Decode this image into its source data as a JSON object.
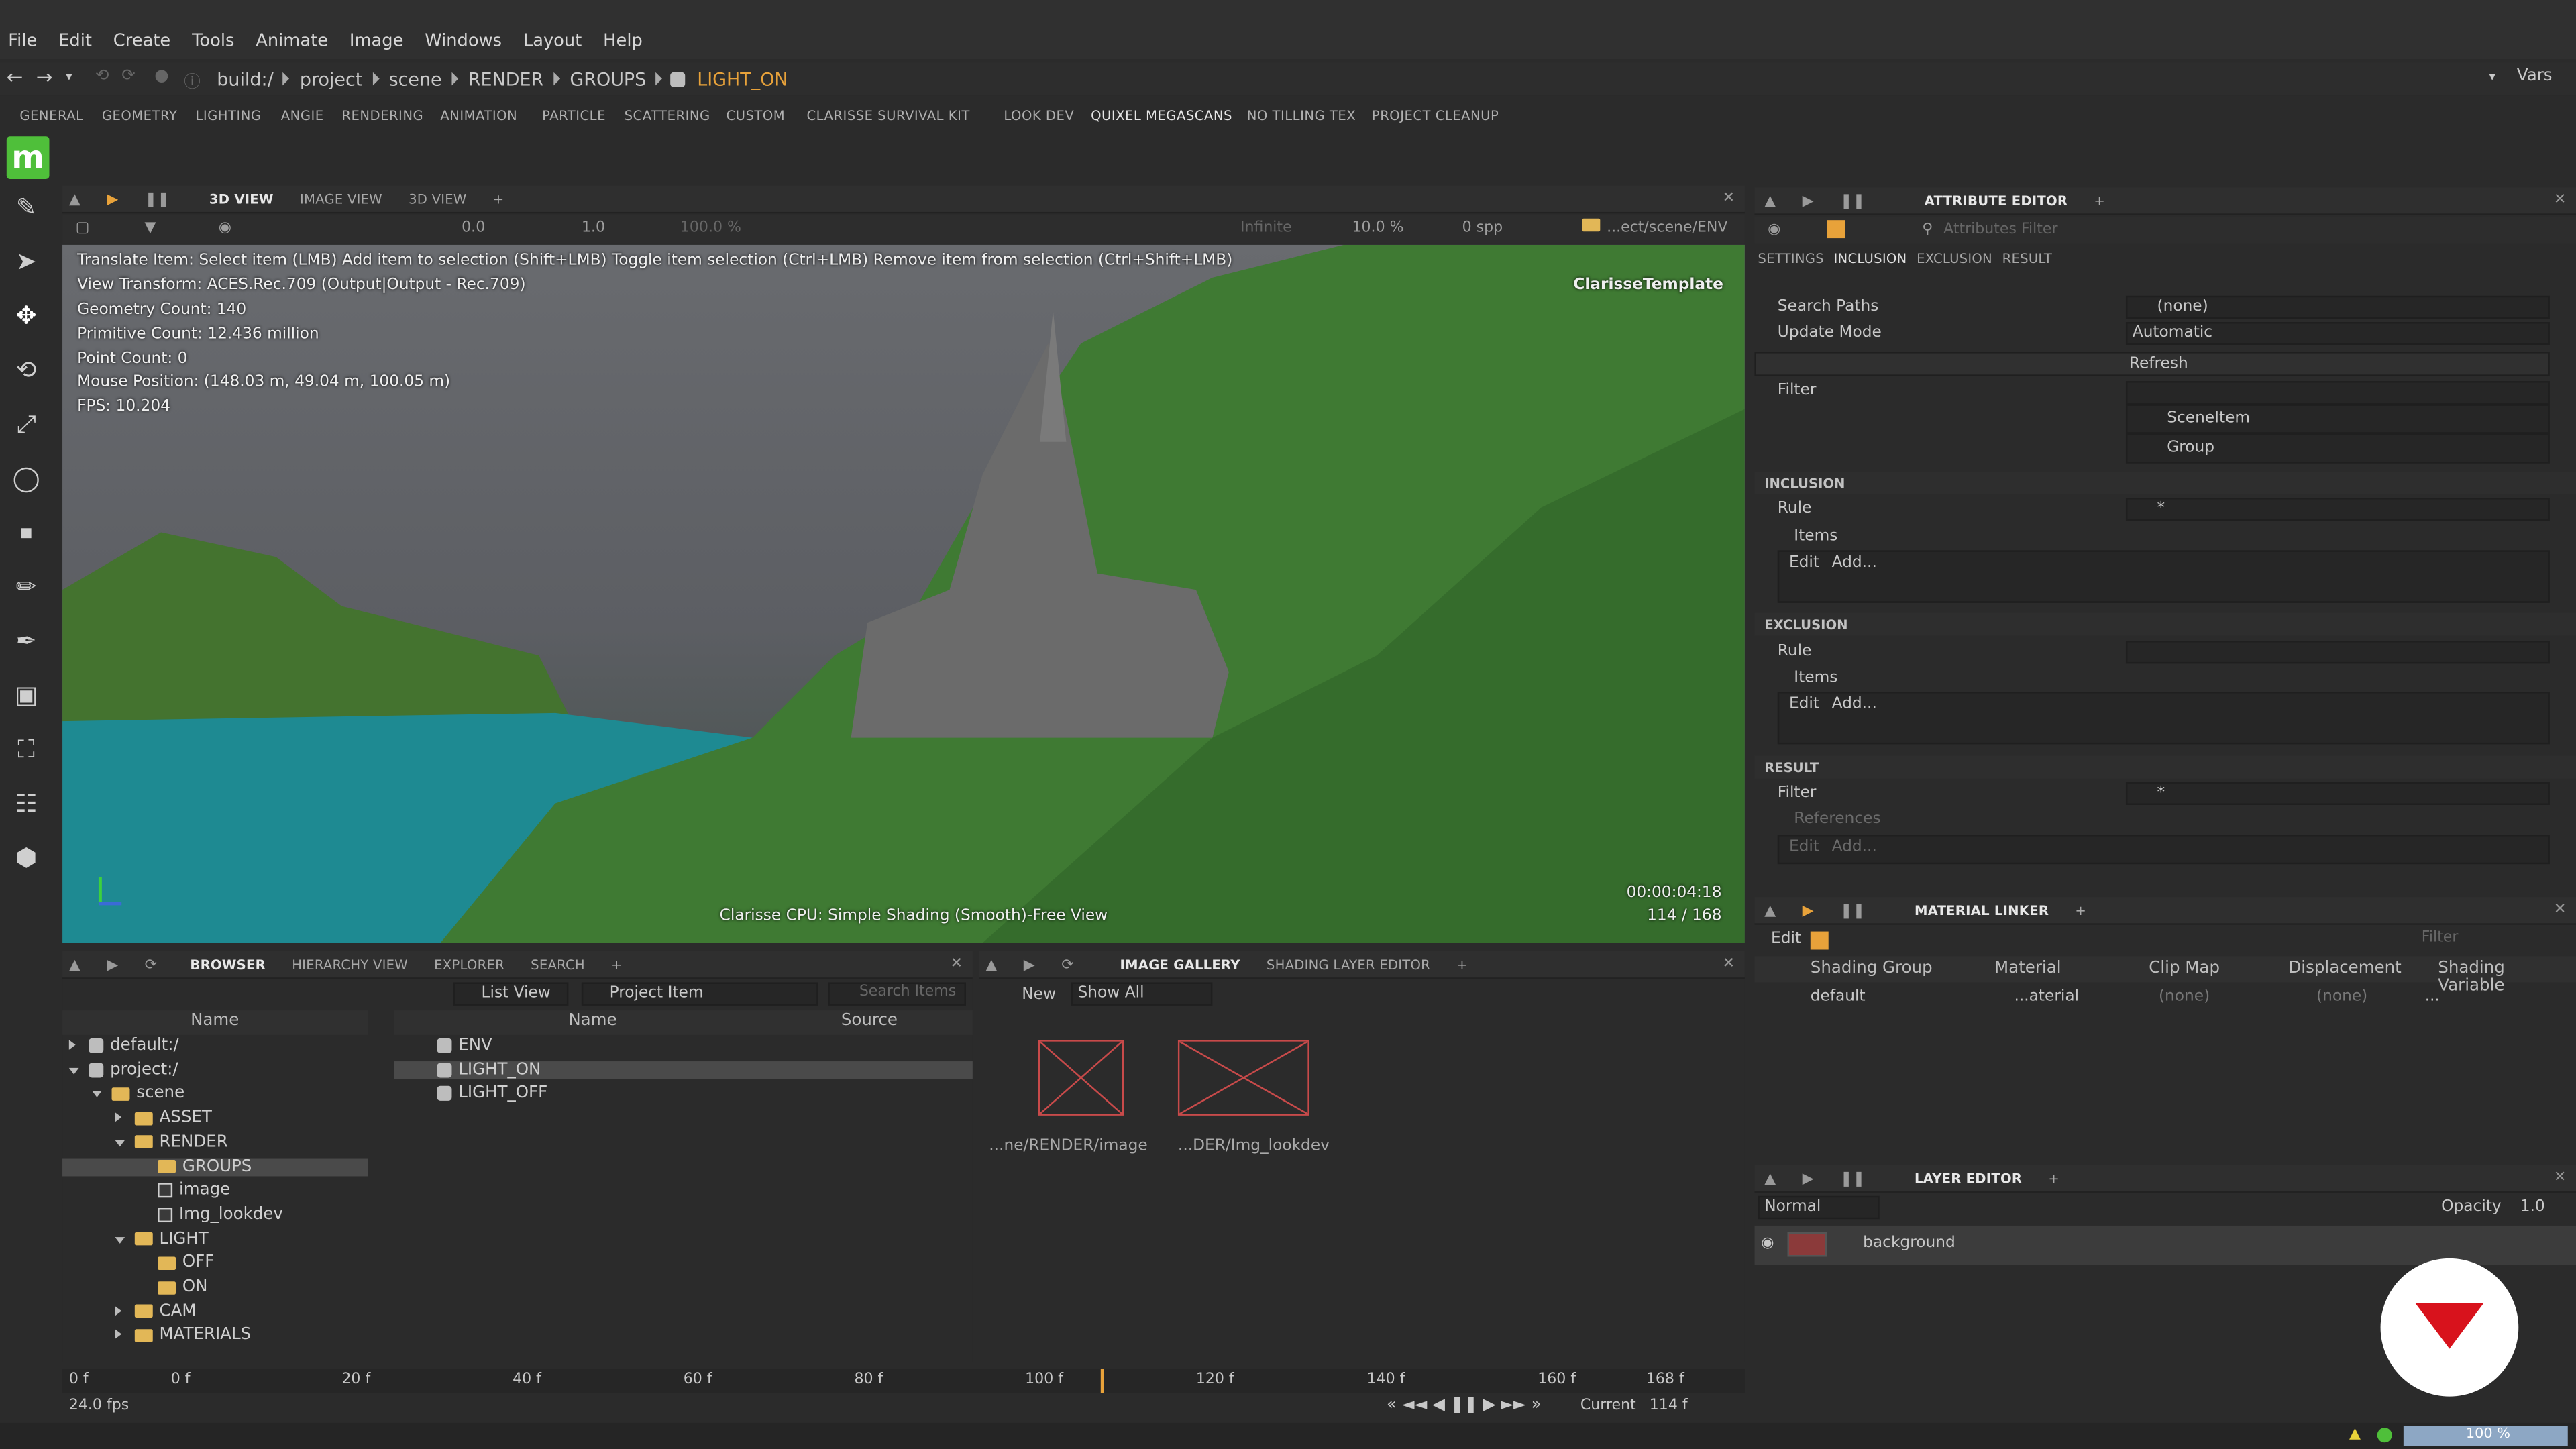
{
  "menu": [
    "File",
    "Edit",
    "Create",
    "Tools",
    "Animate",
    "Image",
    "Windows",
    "Layout",
    "Help"
  ],
  "breadcrumb": [
    "build:/",
    "project",
    "scene",
    "RENDER",
    "GROUPS",
    "LIGHT_ON"
  ],
  "vars_label": "Vars",
  "shelf_tabs": [
    "GENERAL",
    "GEOMETRY",
    "LIGHTING",
    "ANGIE",
    "RENDERING",
    "ANIMATION",
    "PARTICLE",
    "SCATTERING",
    "CUSTOM",
    "CLARISSE SURVIVAL KIT",
    "LOOK DEV",
    "QUIXEL MEGASCANS",
    "NO TILLING TEX",
    "PROJECT CLEANUP"
  ],
  "logo_letter": "m",
  "viewport_panel": {
    "tabs": [
      "3D VIEW",
      "IMAGE VIEW",
      "3D VIEW"
    ],
    "toolbar": {
      "val1": "0.0",
      "val2": "1.0",
      "val3": "100.0 %",
      "infinite": "Infinite",
      "zoom": "10.0 %",
      "spp": "0 spp",
      "path": "...ect/scene/ENV"
    },
    "hint": "Translate Item: Select item (LMB)  Add item to selection (Shift+LMB)  Toggle item selection (Ctrl+LMB)  Remove item from selection (Ctrl+Shift+LMB)",
    "info": [
      "View Transform: ACES.Rec.709 (Output|Output - Rec.709)",
      "Geometry Count: 140",
      "Primitive Count: 12.436 million",
      "Point Count: 0",
      "Mouse Position:  (148.03 m, 49.04 m, 100.05 m)",
      "FPS: 10.204"
    ],
    "template": "ClarisseTemplate",
    "status": "Clarisse CPU: Simple Shading (Smooth)-Free View",
    "timecode": "00:00:04:18",
    "frame": "114 / 168"
  },
  "attr": {
    "title": "ATTRIBUTE EDITOR",
    "filter_placeholder": "Attributes Filter",
    "tabs": [
      "SETTINGS",
      "INCLUSION",
      "EXCLUSION",
      "RESULT"
    ],
    "search_paths_label": "Search Paths",
    "search_paths_value": "(none)",
    "update_mode_label": "Update Mode",
    "update_mode_value": "Automatic",
    "refresh": "Refresh",
    "filter_label": "Filter",
    "filter_items": [
      "SceneItem",
      "Group"
    ],
    "inclusion": "INCLUSION",
    "rule": "Rule",
    "rule_value": "*",
    "items": "Items",
    "edit": "Edit",
    "add": "Add...",
    "exclusion": "EXCLUSION",
    "result": "RESULT",
    "result_filter_value": "*",
    "references": "References"
  },
  "material_linker": {
    "title": "MATERIAL LINKER",
    "edit": "Edit",
    "filter_placeholder": "Filter",
    "columns": [
      "Shading Group",
      "Material",
      "Clip Map",
      "Displacement",
      "Shading Variable"
    ],
    "row": {
      "group": "default",
      "material": "...aterial",
      "clip": "(none)",
      "disp": "(none)",
      "var": "..."
    }
  },
  "layer_editor": {
    "title": "LAYER EDITOR",
    "blend": "Normal",
    "opacity_label": "Opacity",
    "opacity": "1.0",
    "layer": "background"
  },
  "browser": {
    "tabs": [
      "BROWSER",
      "HIERARCHY VIEW",
      "EXPLORER",
      "SEARCH"
    ],
    "list_view": "List View",
    "type": "Project Item",
    "search_placeholder": "Search Items",
    "col_name": "Name",
    "col_name2": "Name",
    "col_source": "Source",
    "tree": [
      {
        "label": "default:/",
        "indent": 0,
        "arrow": "right",
        "icon": "root"
      },
      {
        "label": "project:/",
        "indent": 0,
        "arrow": "down",
        "icon": "root"
      },
      {
        "label": "scene",
        "indent": 1,
        "arrow": "down",
        "icon": "folder"
      },
      {
        "label": "ASSET",
        "indent": 2,
        "arrow": "right",
        "icon": "folder"
      },
      {
        "label": "RENDER",
        "indent": 2,
        "arrow": "down",
        "icon": "folder"
      },
      {
        "label": "GROUPS",
        "indent": 3,
        "arrow": "",
        "icon": "folder",
        "selected": true
      },
      {
        "label": "image",
        "indent": 3,
        "arrow": "",
        "icon": "doc"
      },
      {
        "label": "Img_lookdev",
        "indent": 3,
        "arrow": "",
        "icon": "doc"
      },
      {
        "label": "LIGHT",
        "indent": 2,
        "arrow": "down",
        "icon": "folder"
      },
      {
        "label": "OFF",
        "indent": 3,
        "arrow": "",
        "icon": "folder"
      },
      {
        "label": "ON",
        "indent": 3,
        "arrow": "",
        "icon": "folder"
      },
      {
        "label": "CAM",
        "indent": 2,
        "arrow": "right",
        "icon": "folder"
      },
      {
        "label": "MATERIALS",
        "indent": 2,
        "arrow": "right",
        "icon": "folder"
      }
    ],
    "items": [
      "ENV",
      "LIGHT_ON",
      "LIGHT_OFF"
    ]
  },
  "gallery": {
    "tabs": [
      "IMAGE GALLERY",
      "SHADING LAYER EDITOR"
    ],
    "new": "New",
    "show_all": "Show All",
    "images": [
      "...ne/RENDER/image",
      "...DER/Img_lookdev"
    ]
  },
  "timeline": {
    "start": "0 f",
    "ticks": [
      "0 f",
      "20 f",
      "40 f",
      "60 f",
      "80 f",
      "100 f",
      "120 f",
      "140 f",
      "160 f"
    ],
    "end": "168 f",
    "fps": "24.0 fps",
    "current_label": "Current",
    "current": "114 f",
    "current_fraction": 0.6786
  },
  "status": {
    "percent": "100 %"
  },
  "colors": {
    "accent": "#e8a23a",
    "selected": "#4a4a4a",
    "logo": "#4fbf3a",
    "badge": "#d8121c"
  }
}
